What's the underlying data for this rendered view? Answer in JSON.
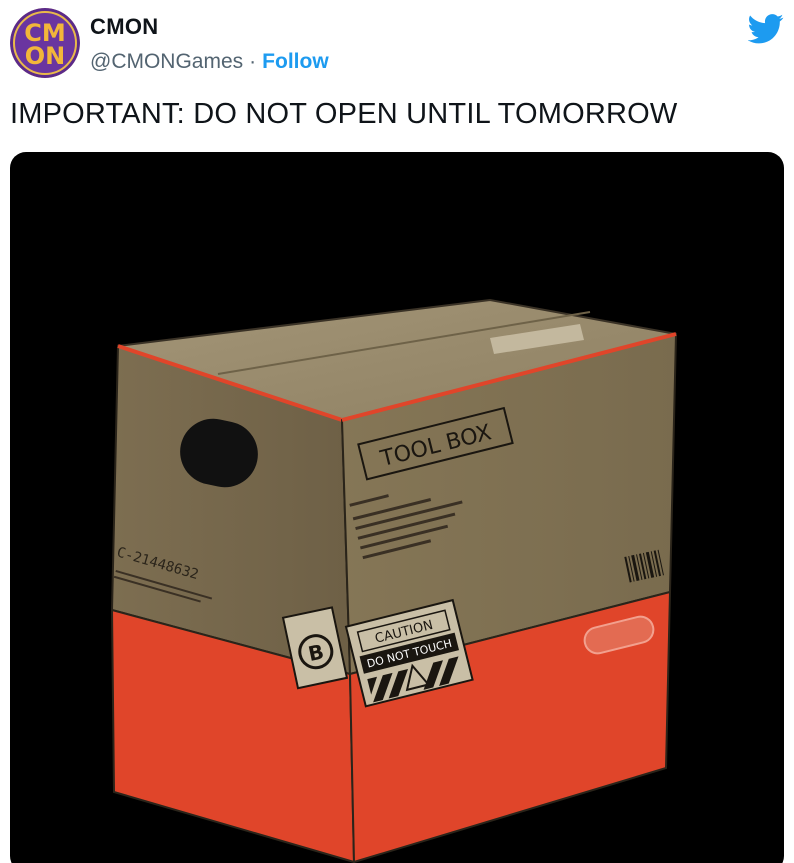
{
  "author": {
    "name": "CMON",
    "handle": "@CMONGames",
    "separator": "·",
    "follow_label": "Follow",
    "avatar_text": {
      "line1": "CM",
      "line2": "ON"
    }
  },
  "tweet": {
    "text": "IMPORTANT: DO NOT OPEN UNTIL TOMORROW"
  },
  "media": {
    "box_labels": {
      "tool_box": "TOOL BOX",
      "code": "C-21448632",
      "caution": "CAUTION",
      "do_not_touch": "DO NOT TOUCH",
      "b_logo": "B"
    }
  },
  "colors": {
    "brand_blue": "#1d9bf0",
    "box_cardboard": "#8a7a5c",
    "box_red": "#e0452a",
    "media_bg": "#000000"
  },
  "icons": {
    "brand": "twitter-bird-icon"
  }
}
